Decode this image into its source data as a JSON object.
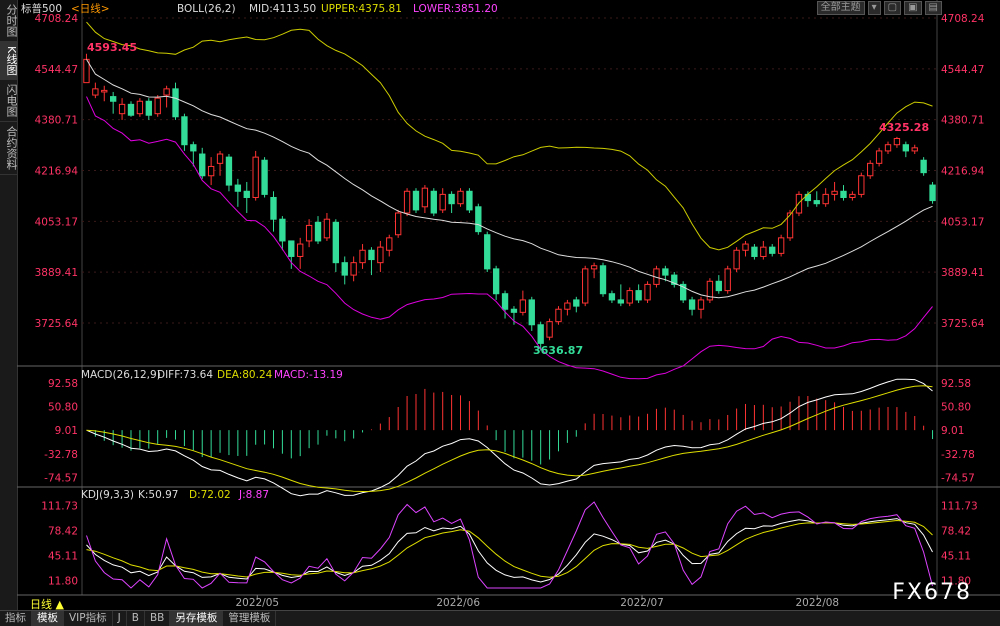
{
  "sidebar": {
    "tabs": [
      "分时图",
      "K线图",
      "闪电图",
      "合约资料"
    ],
    "active": 1
  },
  "header": {
    "instrument": "标普500",
    "period": "<日线>",
    "boll": "BOLL(26,2)",
    "mid": "MID:4113.50",
    "upper": "UPPER:4375.81",
    "lower": "LOWER:3851.20"
  },
  "toolbar": {
    "theme_label": "全部主题"
  },
  "main": {
    "y_ticks": [
      "4708.24",
      "4544.47",
      "4380.71",
      "4216.94",
      "4053.17",
      "3889.41",
      "3725.64"
    ],
    "y_values": [
      4708.24,
      4544.47,
      4380.71,
      4216.94,
      4053.17,
      3889.41,
      3725.64
    ],
    "high_label": "4593.45",
    "high2_label": "4325.28",
    "low_label": "3636.87"
  },
  "macd": {
    "title": "MACD(26,12,9)",
    "diff": "DIFF:73.64",
    "dea": "DEA:80.24",
    "macd": "MACD:-13.19",
    "y_ticks": [
      "92.58",
      "50.80",
      "9.01",
      "-32.78",
      "-74.57"
    ],
    "y_values": [
      92.58,
      50.8,
      9.01,
      -32.78,
      -74.57
    ]
  },
  "kdj": {
    "title": "KDJ(9,3,3)",
    "k": "K:50.97",
    "d": "D:72.02",
    "j": "J:8.87",
    "y_ticks": [
      "111.73",
      "78.42",
      "45.11",
      "11.80"
    ],
    "y_values": [
      111.73,
      78.42,
      45.11,
      11.8
    ]
  },
  "x_labels": [
    "2022/05",
    "2022/06",
    "2022/07",
    "2022/08"
  ],
  "bottom": {
    "period_label": "日线 ▲",
    "tabs": [
      "指标",
      "模板",
      "VIP指标",
      "J",
      "B",
      "BB",
      "另存模板",
      "管理模板"
    ]
  },
  "watermark": "FX678",
  "colors": {
    "up": "#ff3333",
    "down": "#33dd99",
    "mid": "#dddddd",
    "upper": "#cccc00",
    "lower": "#dd00dd",
    "axis": "#ff3366",
    "diff": "#ffffff",
    "dea": "#dddd00",
    "j": "#dd44ff"
  },
  "chart_data": {
    "type": "candlestick",
    "series": [
      {
        "name": "K",
        "ohlc": [
          [
            4500,
            4575,
            4510,
            4593
          ],
          [
            4460,
            4480,
            4450,
            4500
          ],
          [
            4470,
            4475,
            4440,
            4490
          ],
          [
            4455,
            4440,
            4400,
            4470
          ],
          [
            4400,
            4430,
            4380,
            4450
          ],
          [
            4430,
            4395,
            4390,
            4440
          ],
          [
            4400,
            4440,
            4390,
            4450
          ],
          [
            4440,
            4395,
            4380,
            4450
          ],
          [
            4400,
            4450,
            4390,
            4460
          ],
          [
            4460,
            4480,
            4420,
            4490
          ],
          [
            4480,
            4390,
            4380,
            4500
          ],
          [
            4390,
            4300,
            4280,
            4400
          ],
          [
            4300,
            4280,
            4230,
            4310
          ],
          [
            4270,
            4200,
            4190,
            4290
          ],
          [
            4200,
            4230,
            4170,
            4260
          ],
          [
            4240,
            4270,
            4200,
            4280
          ],
          [
            4260,
            4170,
            4150,
            4270
          ],
          [
            4170,
            4150,
            4100,
            4190
          ],
          [
            4150,
            4130,
            4080,
            4180
          ],
          [
            4130,
            4260,
            4120,
            4280
          ],
          [
            4250,
            4140,
            4130,
            4260
          ],
          [
            4130,
            4060,
            4020,
            4150
          ],
          [
            4060,
            3990,
            3960,
            4070
          ],
          [
            3990,
            3940,
            3900,
            3990
          ],
          [
            3940,
            3980,
            3900,
            4000
          ],
          [
            3990,
            4040,
            3970,
            4060
          ],
          [
            4050,
            3990,
            3980,
            4070
          ],
          [
            4000,
            4060,
            3990,
            4080
          ],
          [
            4050,
            3920,
            3890,
            4060
          ],
          [
            3920,
            3880,
            3850,
            3940
          ],
          [
            3880,
            3920,
            3860,
            3940
          ],
          [
            3920,
            3960,
            3900,
            3980
          ],
          [
            3960,
            3930,
            3880,
            3970
          ],
          [
            3920,
            3970,
            3890,
            3990
          ],
          [
            3960,
            4000,
            3940,
            4010
          ],
          [
            4010,
            4080,
            4000,
            4090
          ],
          [
            4080,
            4150,
            4070,
            4160
          ],
          [
            4150,
            4090,
            4080,
            4160
          ],
          [
            4100,
            4160,
            4080,
            4170
          ],
          [
            4150,
            4080,
            4070,
            4160
          ],
          [
            4090,
            4140,
            4080,
            4160
          ],
          [
            4140,
            4110,
            4080,
            4150
          ],
          [
            4110,
            4150,
            4100,
            4160
          ],
          [
            4150,
            4090,
            4080,
            4160
          ],
          [
            4100,
            4020,
            4010,
            4110
          ],
          [
            4010,
            3900,
            3890,
            4020
          ],
          [
            3900,
            3820,
            3800,
            3910
          ],
          [
            3820,
            3770,
            3740,
            3830
          ],
          [
            3770,
            3760,
            3720,
            3780
          ],
          [
            3760,
            3800,
            3750,
            3830
          ],
          [
            3800,
            3720,
            3700,
            3810
          ],
          [
            3720,
            3660,
            3636.87,
            3730
          ],
          [
            3680,
            3730,
            3670,
            3740
          ],
          [
            3730,
            3770,
            3720,
            3780
          ],
          [
            3770,
            3790,
            3750,
            3800
          ],
          [
            3800,
            3780,
            3760,
            3810
          ],
          [
            3790,
            3900,
            3780,
            3910
          ],
          [
            3900,
            3910,
            3870,
            3920
          ],
          [
            3910,
            3820,
            3810,
            3920
          ],
          [
            3820,
            3800,
            3790,
            3830
          ],
          [
            3800,
            3790,
            3780,
            3850
          ],
          [
            3790,
            3830,
            3780,
            3840
          ],
          [
            3830,
            3800,
            3790,
            3850
          ],
          [
            3800,
            3850,
            3790,
            3860
          ],
          [
            3850,
            3900,
            3840,
            3910
          ],
          [
            3900,
            3880,
            3860,
            3910
          ],
          [
            3880,
            3850,
            3840,
            3890
          ],
          [
            3850,
            3800,
            3790,
            3860
          ],
          [
            3800,
            3770,
            3750,
            3810
          ],
          [
            3770,
            3800,
            3740,
            3810
          ],
          [
            3800,
            3860,
            3790,
            3870
          ],
          [
            3860,
            3830,
            3820,
            3880
          ],
          [
            3830,
            3900,
            3820,
            3910
          ],
          [
            3900,
            3960,
            3890,
            3970
          ],
          [
            3960,
            3980,
            3940,
            3990
          ],
          [
            3970,
            3940,
            3930,
            3980
          ],
          [
            3940,
            3970,
            3930,
            3990
          ],
          [
            3970,
            3950,
            3940,
            3980
          ],
          [
            3950,
            4000,
            3940,
            4010
          ],
          [
            4000,
            4080,
            3990,
            4090
          ],
          [
            4080,
            4140,
            4070,
            4150
          ],
          [
            4140,
            4120,
            4100,
            4150
          ],
          [
            4120,
            4110,
            4100,
            4150
          ],
          [
            4110,
            4140,
            4100,
            4160
          ],
          [
            4140,
            4150,
            4120,
            4180
          ],
          [
            4150,
            4130,
            4120,
            4170
          ],
          [
            4130,
            4140,
            4120,
            4150
          ],
          [
            4140,
            4200,
            4130,
            4210
          ],
          [
            4200,
            4240,
            4190,
            4250
          ],
          [
            4240,
            4280,
            4230,
            4290
          ],
          [
            4280,
            4300,
            4270,
            4310
          ],
          [
            4300,
            4320,
            4290,
            4325.28
          ],
          [
            4300,
            4280,
            4260,
            4310
          ],
          [
            4280,
            4290,
            4270,
            4300
          ],
          [
            4250,
            4210,
            4200,
            4260
          ],
          [
            4170,
            4120,
            4110,
            4180
          ]
        ]
      }
    ],
    "xlabel": "",
    "ylabel": "",
    "ylim": [
      3600,
      4708.24
    ],
    "x_tick_labels": [
      "2022/05",
      "2022/06",
      "2022/07",
      "2022/08"
    ],
    "grid": true
  }
}
